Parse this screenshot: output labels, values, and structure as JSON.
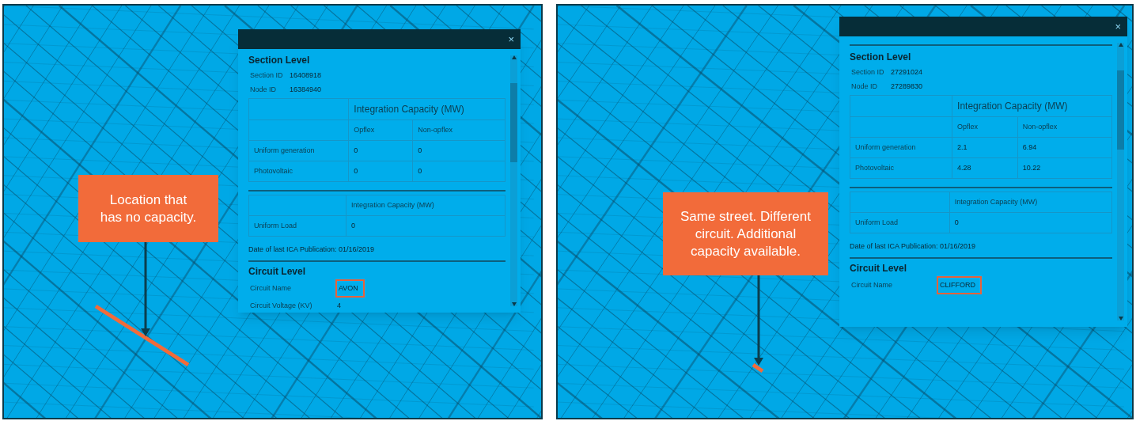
{
  "panels": [
    {
      "callout": "Location that has no capacity.",
      "popup": {
        "close": "×",
        "section_title": "Section Level",
        "fields": [
          {
            "label": "Section ID",
            "value": "16408918"
          },
          {
            "label": "Node ID",
            "value": "16384940"
          }
        ],
        "gen_table": {
          "header": "Integration Capacity (MW)",
          "columns": [
            "Opflex",
            "Non-opflex"
          ],
          "rows": [
            {
              "label": "Uniform generation",
              "values": [
                "0",
                "0"
              ]
            },
            {
              "label": "Photovoltaic",
              "values": [
                "0",
                "0"
              ]
            }
          ]
        },
        "load_table": {
          "header": "Integration Capacity (MW)",
          "rows": [
            {
              "label": "Uniform Load",
              "value": "0"
            }
          ]
        },
        "date_text": "Date of last ICA Publication: 01/16/2019",
        "circuit_title": "Circuit Level",
        "circuit_fields": [
          {
            "label": "Circuit Name",
            "value": "AVON",
            "highlighted": true
          },
          {
            "label": "Circuit Voltage (KV)",
            "value": "4",
            "highlighted": false
          }
        ]
      }
    },
    {
      "callout": "Same street. Different circuit. Additional capacity available.",
      "popup": {
        "close": "×",
        "section_title": "Section Level",
        "fields": [
          {
            "label": "Section ID",
            "value": "27291024"
          },
          {
            "label": "Node ID",
            "value": "27289830"
          }
        ],
        "gen_table": {
          "header": "Integration Capacity (MW)",
          "columns": [
            "Opflex",
            "Non-opflex"
          ],
          "rows": [
            {
              "label": "Uniform generation",
              "values": [
                "2.1",
                "6.94"
              ]
            },
            {
              "label": "Photovoltaic",
              "values": [
                "4.28",
                "10.22"
              ]
            }
          ]
        },
        "load_table": {
          "header": "Integration Capacity (MW)",
          "rows": [
            {
              "label": "Uniform Load",
              "value": "0"
            }
          ]
        },
        "date_text": "Date of last ICA Publication: 01/16/2019",
        "circuit_title": "Circuit Level",
        "circuit_fields": [
          {
            "label": "Circuit Name",
            "value": "CLIFFORD",
            "highlighted": true
          }
        ]
      }
    }
  ]
}
